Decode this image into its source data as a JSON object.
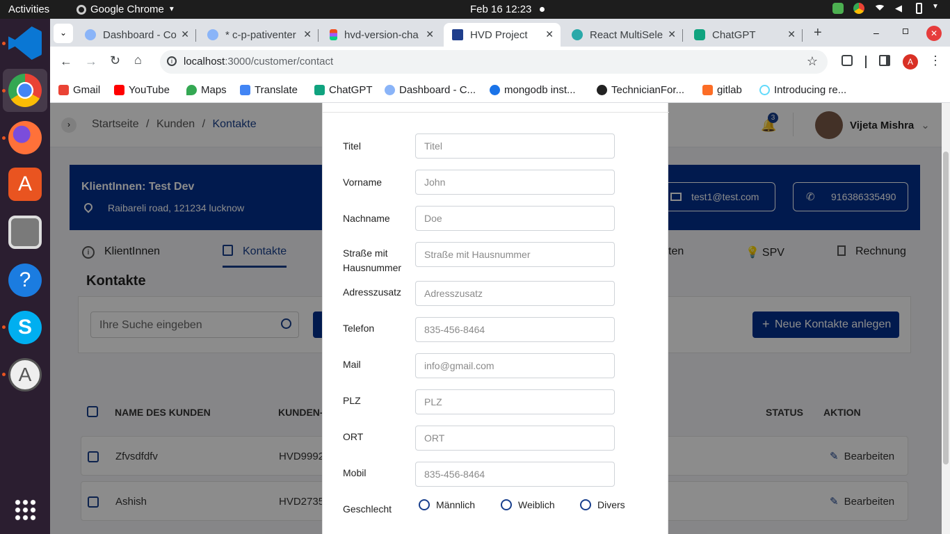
{
  "os": {
    "activities": "Activities",
    "app_name": "Google Chrome",
    "clock": "Feb 16  12:23"
  },
  "browser": {
    "tabs": [
      {
        "title": "Dashboard - Co",
        "active": false
      },
      {
        "title": "* c-p-pativenter",
        "active": false
      },
      {
        "title": "hvd-version-cha",
        "active": false
      },
      {
        "title": "HVD Project",
        "active": true
      },
      {
        "title": "React MultiSele",
        "active": false
      },
      {
        "title": "ChatGPT",
        "active": false
      }
    ],
    "url_host": "localhost",
    "url_path": ":3000/customer/contact",
    "profile_initial": "A",
    "bookmarks": [
      "Gmail",
      "YouTube",
      "Maps",
      "Translate",
      "ChatGPT",
      "Dashboard - C...",
      "mongodb inst...",
      "TechnicianFor...",
      "gitlab",
      "Introducing re..."
    ]
  },
  "page": {
    "breadcrumb": {
      "home": "Startseite",
      "sep": "/",
      "customers": "Kunden",
      "current": "Kontakte"
    },
    "notification_count": "3",
    "user_name": "Vijeta Mishra",
    "client": {
      "name": "KlientInnen: Test Dev",
      "address": "Raibareli road, 121234 lucknow",
      "email": "test1@test.com",
      "phone": "916386335490"
    },
    "tabs": {
      "clients": "KlientInnen",
      "contacts": "Kontakte",
      "partial": "ten",
      "spv": "SPV",
      "invoice": "Rechnung"
    },
    "section_title": "Kontakte",
    "search_placeholder": "Ihre Suche eingeben",
    "new_button": "Neue Kontakte anlegen",
    "table": {
      "headers": {
        "name": "NAME DES KUNDEN",
        "id": "KUNDEN-I",
        "status": "STATUS",
        "action": "AKTION"
      },
      "rows": [
        {
          "name": "Zfvsdfdfv",
          "id": "HVD9992",
          "action": "Bearbeiten"
        },
        {
          "name": "Ashish",
          "id": "HVD2735",
          "action": "Bearbeiten"
        }
      ]
    }
  },
  "modal": {
    "fields": [
      {
        "label": "Titel",
        "placeholder": "Titel"
      },
      {
        "label": "Vorname",
        "placeholder": "John"
      },
      {
        "label": "Nachname",
        "placeholder": "Doe"
      },
      {
        "label": "Straße mit Hausnummer",
        "placeholder": "Straße mit Hausnummer"
      },
      {
        "label": "Adresszusatz",
        "placeholder": "Adresszusatz"
      },
      {
        "label": "Telefon",
        "placeholder": "835-456-8464"
      },
      {
        "label": "Mail",
        "placeholder": "info@gmail.com"
      },
      {
        "label": "PLZ",
        "placeholder": "PLZ"
      },
      {
        "label": "ORT",
        "placeholder": "ORT"
      },
      {
        "label": "Mobil",
        "placeholder": "835-456-8464"
      }
    ],
    "gender": {
      "label": "Geschlecht",
      "options": [
        "Männlich",
        "Weiblich",
        "Divers"
      ]
    }
  }
}
